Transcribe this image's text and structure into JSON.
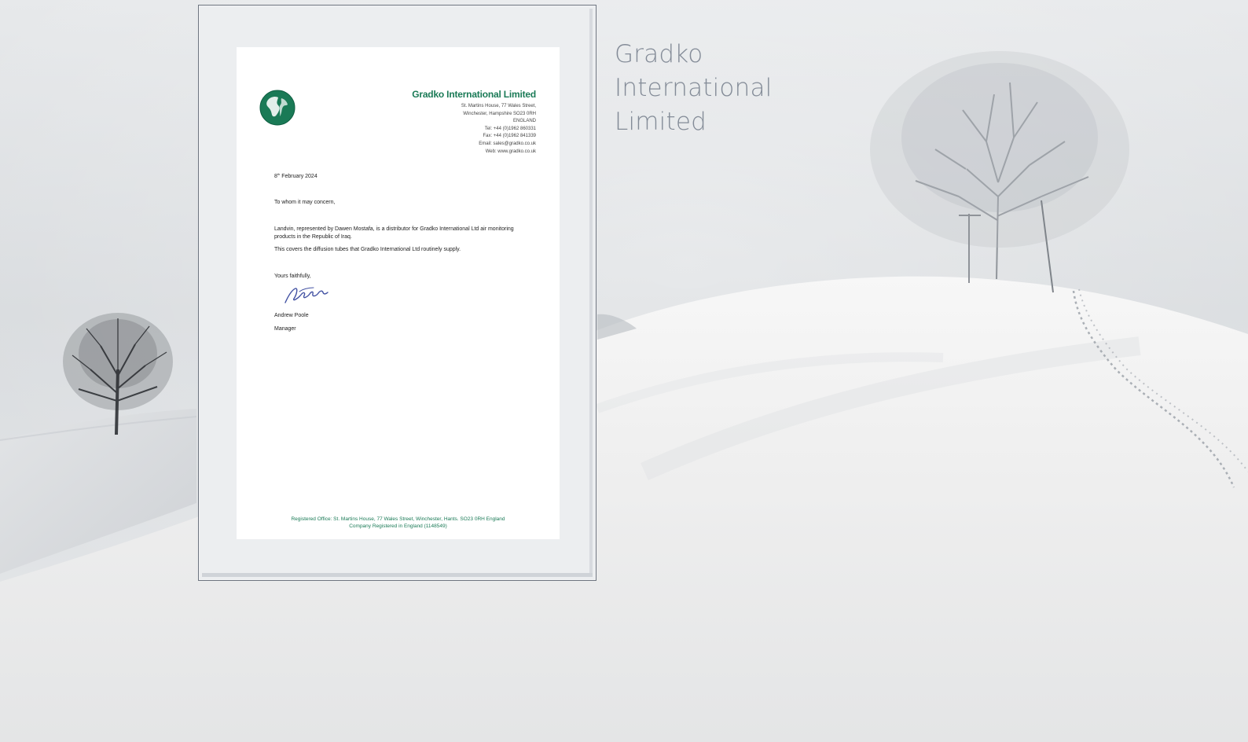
{
  "title": {
    "lines": [
      "Gradko",
      "International",
      "Limited"
    ]
  },
  "letter": {
    "company_name": "Gradko International Limited",
    "address_lines": [
      "St. Martins House, 77 Wales Street,",
      "Winchester, Hampshire SO23 0RH",
      "ENGLAND",
      "Tel: +44 (0)1962 860331",
      "Fax: +44 (0)1962 841339",
      "Email: sales@gradko.co.uk",
      "Web: www.gradko.co.uk"
    ],
    "date": "8",
    "date_suffix": "th",
    "date_rest": " February 2024",
    "greeting": "To whom it may concern,",
    "paragraph_1": "Landvin, represented by Dawen Mostafa, is a distributor for Gradko International Ltd air monitoring products in the Republic of Iraq.",
    "paragraph_2": "This covers the diffusion tubes that Gradko International Ltd routinely supply.",
    "closing": "Yours faithfully,",
    "signer_name": "Andrew Poole",
    "signer_title": "Manager",
    "footer_line_1": "Registered Office: St. Martins House, 77 Wales Street, Winchester, Hants. SO23 0RH England",
    "footer_line_2": "Company Registered in England (1148549)"
  },
  "colors": {
    "brand_green": "#1a7a56",
    "title_gray": "#838b97"
  },
  "icons": {
    "logo": "globe-icon",
    "signature": "signature-icon"
  }
}
